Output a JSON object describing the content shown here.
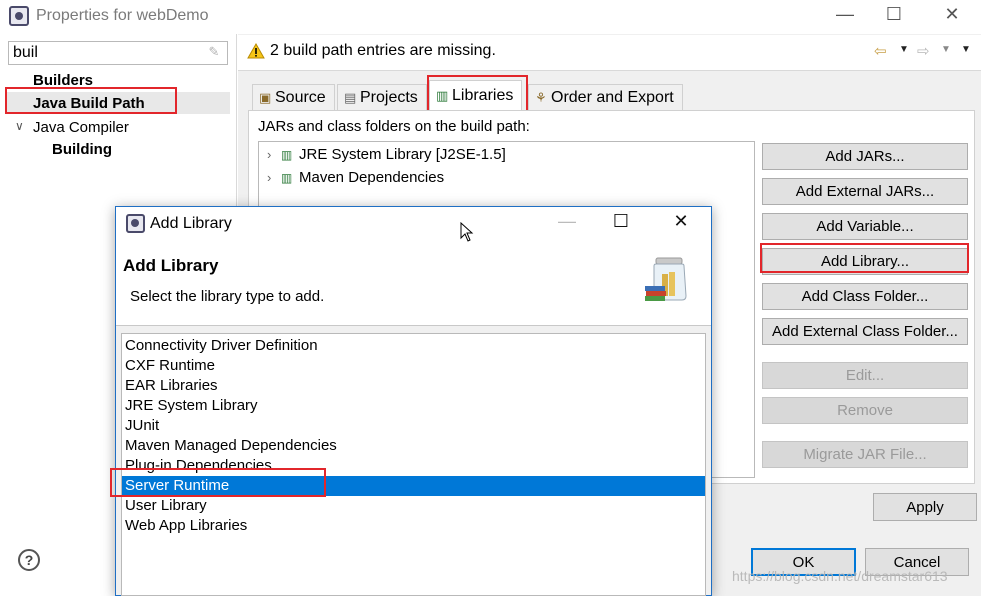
{
  "window": {
    "title": "Properties for webDemo",
    "controls": {
      "minimize": "—",
      "maximize": "☐",
      "close": "✕"
    }
  },
  "left": {
    "filter_value": "buil",
    "tree": [
      {
        "label": "Builders",
        "bold": true
      },
      {
        "label": "Java Build Path",
        "bold": true,
        "highlighted": true
      },
      {
        "label": "Java Compiler",
        "bold": false,
        "expanded": true
      },
      {
        "label": "Building",
        "bold": true
      }
    ]
  },
  "message": {
    "text": "2 build path entries are missing.",
    "icon": "warning-icon"
  },
  "tabs": [
    {
      "label": "Source",
      "icon": "source-folder-icon"
    },
    {
      "label": "Projects",
      "icon": "projects-icon"
    },
    {
      "label": "Libraries",
      "icon": "libraries-icon",
      "active": true
    },
    {
      "label": "Order and Export",
      "icon": "order-export-icon"
    }
  ],
  "libraries": {
    "label": "JARs and class folders on the build path:",
    "entries": [
      {
        "label": "JRE System Library [J2SE-1.5]"
      },
      {
        "label": "Maven Dependencies"
      }
    ]
  },
  "buttons": {
    "add_jars": "Add JARs...",
    "add_external_jars": "Add External JARs...",
    "add_variable": "Add Variable...",
    "add_library": "Add Library...",
    "add_class_folder": "Add Class Folder...",
    "add_external_class_folder": "Add External Class Folder...",
    "edit": "Edit...",
    "remove": "Remove",
    "migrate_jar": "Migrate JAR File...",
    "apply": "Apply",
    "ok": "OK",
    "cancel": "Cancel"
  },
  "watermark": "https://blog.csdn.net/dreamstar613",
  "dialog": {
    "title": "Add Library",
    "heading": "Add Library",
    "description": "Select the library type to add.",
    "options": [
      {
        "label": "Connectivity Driver Definition"
      },
      {
        "label": "CXF Runtime"
      },
      {
        "label": "EAR Libraries"
      },
      {
        "label": "JRE System Library"
      },
      {
        "label": "JUnit"
      },
      {
        "label": "Maven Managed Dependencies"
      },
      {
        "label": "Plug-in Dependencies"
      },
      {
        "label": "Server Runtime",
        "selected": true
      },
      {
        "label": "User Library"
      },
      {
        "label": "Web App Libraries"
      }
    ]
  },
  "colors": {
    "selection": "#0078d7",
    "highlight_box": "#e2262b",
    "dialog_border": "#1f6fc4"
  }
}
